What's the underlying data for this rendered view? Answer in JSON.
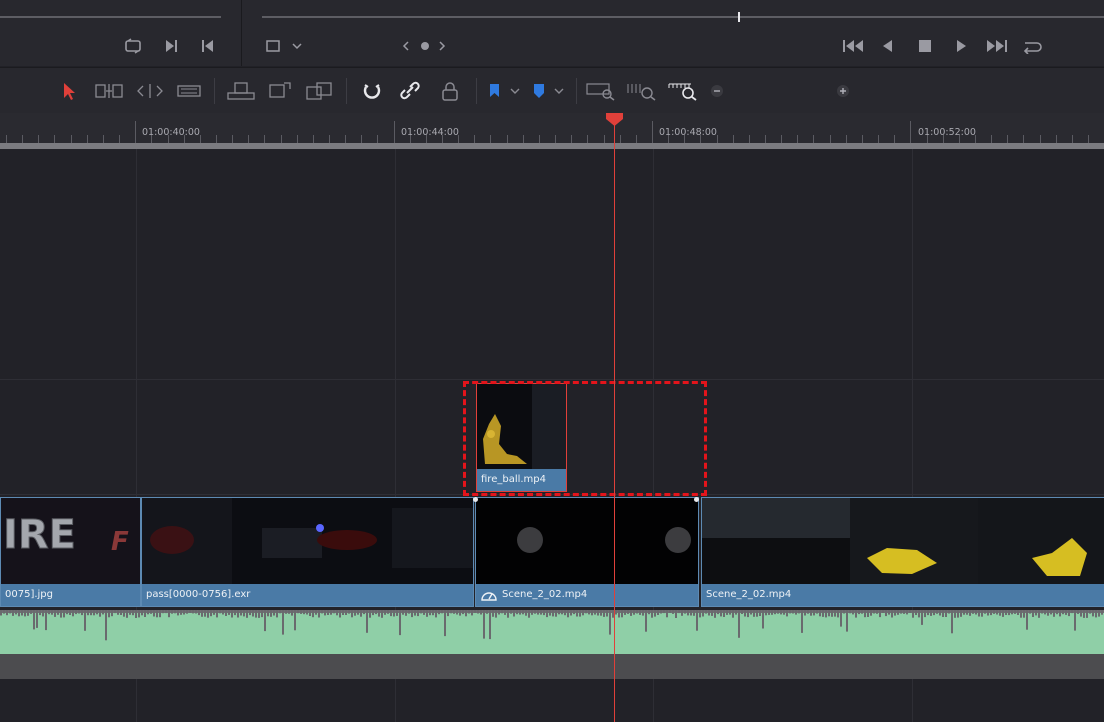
{
  "toolbar": {
    "tools": [
      "select-tool",
      "trim-edit-tool",
      "dynamic-trim-tool",
      "blade-tool",
      "insert-clip",
      "overwrite-clip",
      "replace-clip",
      "snapping",
      "linked-selection",
      "position-lock",
      "flag",
      "marker",
      "full-zoom",
      "detail-zoom",
      "custom-zoom",
      "zoom-out",
      "zoom-in"
    ]
  },
  "ruler": {
    "timecodes": [
      "01:00:40:00",
      "01:00:44:00",
      "01:00:48:00",
      "01:00:52:00"
    ]
  },
  "clips": {
    "fire_ball": "fire_ball.mp4",
    "jpg": "0075].jpg",
    "exr": "pass[0000-0756].exr",
    "scene_a": "Scene_2_02.mp4",
    "scene_b": "Scene_2_02.mp4"
  },
  "colors": {
    "playhead": "#e0403a",
    "clip_label": "#4a7aa6",
    "audio": "#8fcfa7",
    "highlight": "#e3141b"
  },
  "zoom_level": 0.72
}
